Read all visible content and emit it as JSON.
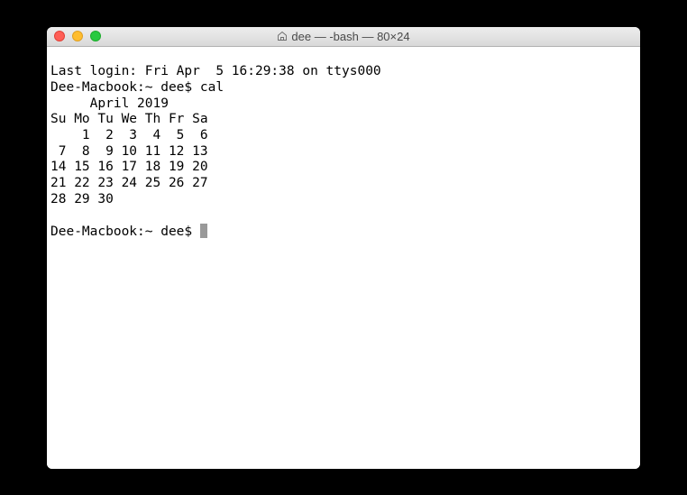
{
  "window": {
    "title": "dee — -bash — 80×24"
  },
  "terminal": {
    "last_login": "Last login: Fri Apr  5 16:29:38 on ttys000",
    "prompt1": "Dee-Macbook:~ dee$ ",
    "command": "cal",
    "cal_header": "     April 2019",
    "cal_days": "Su Mo Tu We Th Fr Sa",
    "cal_row1": "    1  2  3  4  5  6",
    "cal_row2": " 7  8  9 10 11 12 13",
    "cal_row3": "14 15 16 17 18 19 20",
    "cal_row4": "21 22 23 24 25 26 27",
    "cal_row5": "28 29 30",
    "blank": "",
    "prompt2": "Dee-Macbook:~ dee$ "
  }
}
